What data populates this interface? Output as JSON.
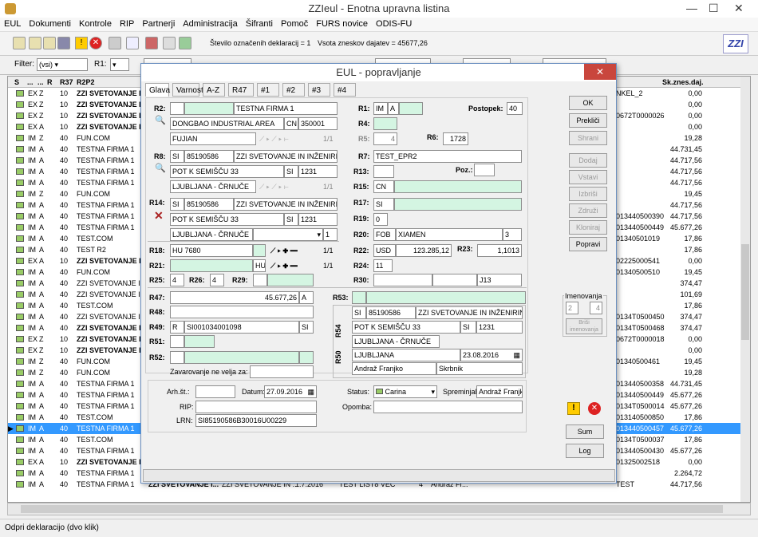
{
  "app": {
    "title": "ZZIeul - Enotna upravna listina"
  },
  "menu": [
    "EUL",
    "Dokumenti",
    "Kontrole",
    "RIP",
    "Partnerji",
    "Administracija",
    "Šifranti",
    "Pomoč",
    "FURS novice",
    "ODIS-FU"
  ],
  "toolbar": {
    "count_text": "Število označenih deklaracij = 1",
    "sum_text": "Vsota zneskov dajatev = 45677,26"
  },
  "filter": {
    "label": "Filter:",
    "value": "(vsi)",
    "r1_label": "R1:"
  },
  "grid": {
    "headers": [
      "S",
      "...",
      "...",
      "R",
      "R37",
      "R2P2"
    ],
    "right_header": "Sk.znes.daj.",
    "rows": [
      {
        "t": "EX",
        "r": "Z",
        "r37": "10",
        "name": "ZZI SVETOVANJE I...",
        "bold": true,
        "mid": "NKEL_2",
        "amt": "0,00"
      },
      {
        "t": "EX",
        "r": "Z",
        "r37": "10",
        "name": "ZZI SVETOVANJE I...",
        "bold": true,
        "mid": "",
        "amt": "0,00"
      },
      {
        "t": "EX",
        "r": "Z",
        "r37": "10",
        "name": "ZZI SVETOVANJE I...",
        "bold": true,
        "mid": "0672T0000026",
        "amt": "0,00"
      },
      {
        "t": "EX",
        "r": "A",
        "r37": "10",
        "name": "ZZI SVETOVANJE I...",
        "bold": true,
        "mid": "",
        "amt": "0,00"
      },
      {
        "t": "IM",
        "r": "Z",
        "r37": "40",
        "name": "FUN.COM",
        "bold": false,
        "mid": "",
        "amt": "19,28"
      },
      {
        "t": "IM",
        "r": "A",
        "r37": "40",
        "name": "TESTNA FIRMA 1",
        "bold": false,
        "mid": "",
        "amt": "44.731,45"
      },
      {
        "t": "IM",
        "r": "A",
        "r37": "40",
        "name": "TESTNA FIRMA 1",
        "bold": false,
        "mid": "",
        "amt": "44.717,56"
      },
      {
        "t": "IM",
        "r": "A",
        "r37": "40",
        "name": "TESTNA FIRMA 1",
        "bold": false,
        "mid": "",
        "amt": "44.717,56"
      },
      {
        "t": "IM",
        "r": "A",
        "r37": "40",
        "name": "TESTNA FIRMA 1",
        "bold": false,
        "mid": "",
        "amt": "44.717,56"
      },
      {
        "t": "IM",
        "r": "Z",
        "r37": "40",
        "name": "FUN.COM",
        "bold": false,
        "mid": "",
        "amt": "19,45"
      },
      {
        "t": "IM",
        "r": "A",
        "r37": "40",
        "name": "TESTNA FIRMA 1",
        "bold": false,
        "mid": "",
        "amt": "44.717,56"
      },
      {
        "t": "IM",
        "r": "A",
        "r37": "40",
        "name": "TESTNA FIRMA 1",
        "bold": false,
        "mid": "013440500390",
        "amt": "44.717,56"
      },
      {
        "t": "IM",
        "r": "A",
        "r37": "40",
        "name": "TESTNA FIRMA 1",
        "bold": false,
        "mid": "013440500449",
        "amt": "45.677,26"
      },
      {
        "t": "IM",
        "r": "A",
        "r37": "40",
        "name": "TEST.COM",
        "bold": false,
        "mid": "01340501019",
        "amt": "17,86"
      },
      {
        "t": "IM",
        "r": "A",
        "r37": "40",
        "name": "TEST R2",
        "bold": false,
        "mid": "",
        "amt": "17,86"
      },
      {
        "t": "EX",
        "r": "A",
        "r37": "10",
        "name": "ZZI SVETOVANJE I...",
        "bold": true,
        "mid": "02225000541",
        "amt": "0,00"
      },
      {
        "t": "IM",
        "r": "A",
        "r37": "40",
        "name": "FUN.COM",
        "bold": false,
        "mid": "01340500510",
        "amt": "19,45"
      },
      {
        "t": "IM",
        "r": "A",
        "r37": "40",
        "name": "ZZI SVETOVANJE IN",
        "bold": false,
        "mid": "",
        "amt": "374,47"
      },
      {
        "t": "IM",
        "r": "A",
        "r37": "40",
        "name": "ZZI SVETOVANJE IN",
        "bold": false,
        "mid": "",
        "amt": "101,69"
      },
      {
        "t": "IM",
        "r": "A",
        "r37": "40",
        "name": "TEST.COM",
        "bold": false,
        "mid": "",
        "amt": "17,86"
      },
      {
        "t": "IM",
        "r": "A",
        "r37": "40",
        "name": "ZZI SVETOVANJE IN",
        "bold": false,
        "mid": "0134T0500450",
        "amt": "374,47"
      },
      {
        "t": "IM",
        "r": "A",
        "r37": "40",
        "name": "ZZI SVETOVANJE IN",
        "bold": true,
        "mid": "0134T0500468",
        "amt": "374,47"
      },
      {
        "t": "EX",
        "r": "Z",
        "r37": "10",
        "name": "ZZI SVETOVANJE I...",
        "bold": true,
        "mid": "0672T0000018",
        "amt": "0,00"
      },
      {
        "t": "EX",
        "r": "Z",
        "r37": "10",
        "name": "ZZI SVETOVANJE I...",
        "bold": true,
        "mid": "",
        "amt": "0,00"
      },
      {
        "t": "IM",
        "r": "Z",
        "r37": "40",
        "name": "FUN.COM",
        "bold": false,
        "mid": "01340500461",
        "amt": "19,45"
      },
      {
        "t": "IM",
        "r": "Z",
        "r37": "40",
        "name": "FUN.COM",
        "bold": false,
        "mid": "",
        "amt": "19,28"
      },
      {
        "t": "IM",
        "r": "A",
        "r37": "40",
        "name": "TESTNA FIRMA 1",
        "bold": false,
        "mid": "013440500358",
        "amt": "44.731,45"
      },
      {
        "t": "IM",
        "r": "A",
        "r37": "40",
        "name": "TESTNA FIRMA 1",
        "bold": false,
        "mid": "013440500449",
        "amt": "45.677,26"
      },
      {
        "t": "IM",
        "r": "A",
        "r37": "40",
        "name": "TESTNA FIRMA 1",
        "bold": false,
        "mid": "0134T0500014",
        "amt": "45.677,26"
      },
      {
        "t": "IM",
        "r": "A",
        "r37": "40",
        "name": "TEST.COM",
        "bold": false,
        "mid": "013140500850",
        "amt": "17,86"
      },
      {
        "t": "IM",
        "r": "A",
        "r37": "40",
        "name": "TESTNA FIRMA 1",
        "bold": false,
        "mid": "013440500457",
        "amt": "45.677,26",
        "sel": true
      },
      {
        "t": "IM",
        "r": "A",
        "r37": "40",
        "name": "TEST.COM",
        "bold": false,
        "mid": "0134T0500037",
        "amt": "17,86"
      },
      {
        "t": "IM",
        "r": "A",
        "r37": "40",
        "name": "TESTNA FIRMA 1",
        "bold": false,
        "mid": "013440500430",
        "amt": "45.677,26"
      },
      {
        "t": "EX",
        "r": "A",
        "r37": "10",
        "name": "ZZI SVETOVANJE I...",
        "bold": true,
        "mid": "01325002518",
        "amt": "0,00"
      },
      {
        "t": "IM",
        "r": "A",
        "r37": "40",
        "name": "TESTNA FIRMA 1",
        "bold": false,
        "mid": "",
        "amt": "2.264,72"
      },
      {
        "t": "IM",
        "r": "A",
        "r37": "40",
        "name": "TESTNA FIRMA 1",
        "bold": false,
        "mid": "TEST",
        "amt": "44.717,56"
      }
    ],
    "partial_row_extra": {
      "a": "ZZI SVETOVANJE I...",
      "b": "ZZI SVETOVANJE IN ...",
      "c": "1.7.2016",
      "d": "TEST LIST8 VEC",
      "e": "4",
      "f": "Andraž Fr..."
    }
  },
  "dialog": {
    "title": "EUL - popravljanje",
    "close": "✕",
    "tabs": [
      "Glava",
      "Varnost",
      "A-Z",
      "R47",
      "#1",
      "#2",
      "#3",
      "#4"
    ],
    "r2": {
      "label": "R2:",
      "name": "TESTNA FIRMA 1",
      "addr": "DONGBAO INDUSTRIAL AREA",
      "cc": "CN",
      "zip": "350001",
      "city": "FUJIAN",
      "pager": "1/1"
    },
    "r8": {
      "label": "R8:",
      "cc": "SI",
      "id": "85190586",
      "name": "ZZI SVETOVANJE IN INŽENIRING,",
      "addr": "POT K SEMIŠČU 33",
      "cc2": "SI",
      "zip": "1231",
      "city": "LJUBLJANA - ČRNUČE",
      "pager": "1/1"
    },
    "r14": {
      "label": "R14:",
      "cc": "SI",
      "id": "85190586",
      "name": "ZZI SVETOVANJE IN INŽENIRING,",
      "addr": "POT K SEMIŠČU 33",
      "cc2": "SI",
      "zip": "1231",
      "city": "LJUBLJANA - ČRNUČE",
      "num": "1"
    },
    "r18": {
      "label": "R18:",
      "value": "HU 7680",
      "pager": "1/1"
    },
    "r21": {
      "label": "R21:",
      "cc": "HU",
      "pager": "1/1"
    },
    "r25": {
      "label": "R25:",
      "value": "4"
    },
    "r26": {
      "label": "R26:",
      "value": "4"
    },
    "r29": {
      "label": "R29:"
    },
    "r1": {
      "label": "R1:",
      "a": "IM",
      "b": "A"
    },
    "postopek": {
      "label": "Postopek:",
      "value": "40"
    },
    "r4": {
      "label": "R4:"
    },
    "r5": {
      "label": "R5:",
      "value": "4"
    },
    "r6": {
      "label": "R6:",
      "value": "1728"
    },
    "r7": {
      "label": "R7:",
      "value": "TEST_EPR2"
    },
    "r13": {
      "label": "R13:"
    },
    "poz": {
      "label": "Poz.:"
    },
    "r15": {
      "label": "R15:",
      "value": "CN"
    },
    "r17": {
      "label": "R17:",
      "value": "SI"
    },
    "r19": {
      "label": "R19:",
      "value": "0"
    },
    "r20": {
      "label": "R20:",
      "a": "FOB",
      "b": "XIAMEN",
      "c": "3"
    },
    "r22": {
      "label": "R22:",
      "cur": "USD",
      "amt": "123.285,12"
    },
    "r23": {
      "label": "R23:",
      "value": "1,1013"
    },
    "r24": {
      "label": "R24:",
      "value": "11"
    },
    "r30": {
      "label": "R30:",
      "value": "J13"
    },
    "r47": {
      "label": "R47:",
      "value": "45.677,26",
      "code": "A"
    },
    "r48": {
      "label": "R48:"
    },
    "r49": {
      "label": "R49:",
      "a": "R",
      "b": "SI001034001098",
      "c": "SI"
    },
    "r51": {
      "label": "R51:"
    },
    "r52": {
      "label": "R52:"
    },
    "zavarovanje": {
      "label": "Zavarovanje ne velja za:"
    },
    "r53": {
      "label": "R53:"
    },
    "r54": {
      "label": "R54",
      "cc": "SI",
      "id": "85190586",
      "name": "ZZI SVETOVANJE IN INŽENIRING,",
      "addr": "POT K SEMIŠČU 33",
      "cc2": "SI",
      "zip": "1231",
      "city": "LJUBLJANA - ČRNUČE"
    },
    "r50": {
      "label": "R50",
      "city": "LJUBLJANA",
      "date": "23.08.2016",
      "person": "Andraž Franjko",
      "role": "Skrbnik"
    },
    "arh": {
      "label": "Arh.št.:"
    },
    "datum": {
      "label": "Datum:",
      "value": "27.09.2016"
    },
    "rip": {
      "label": "RIP:"
    },
    "lrn": {
      "label": "LRN:",
      "value": "SI85190586B30016U00229"
    },
    "status": {
      "label": "Status:",
      "value": "Carina"
    },
    "spreminjal": {
      "label": "Spreminjal:",
      "value": "Andraž Franjk"
    },
    "opomba": {
      "label": "Opomba:"
    },
    "buttons": {
      "ok": "OK",
      "preklici": "Prekliči",
      "shrani": "Shrani",
      "dodaj": "Dodaj",
      "vstavi": "Vstavi",
      "izbrisi": "Izbriši",
      "zdruzi": "Združi",
      "kloniraj": "Kloniraj",
      "popravi": "Popravi",
      "sum": "Sum",
      "log": "Log"
    },
    "imenovanja": {
      "label": "Imenovanja",
      "a": "2",
      "b": "4",
      "btn": "Briši imenovanja"
    }
  },
  "status_bar": "Odpri deklaracijo (dvo klik)"
}
